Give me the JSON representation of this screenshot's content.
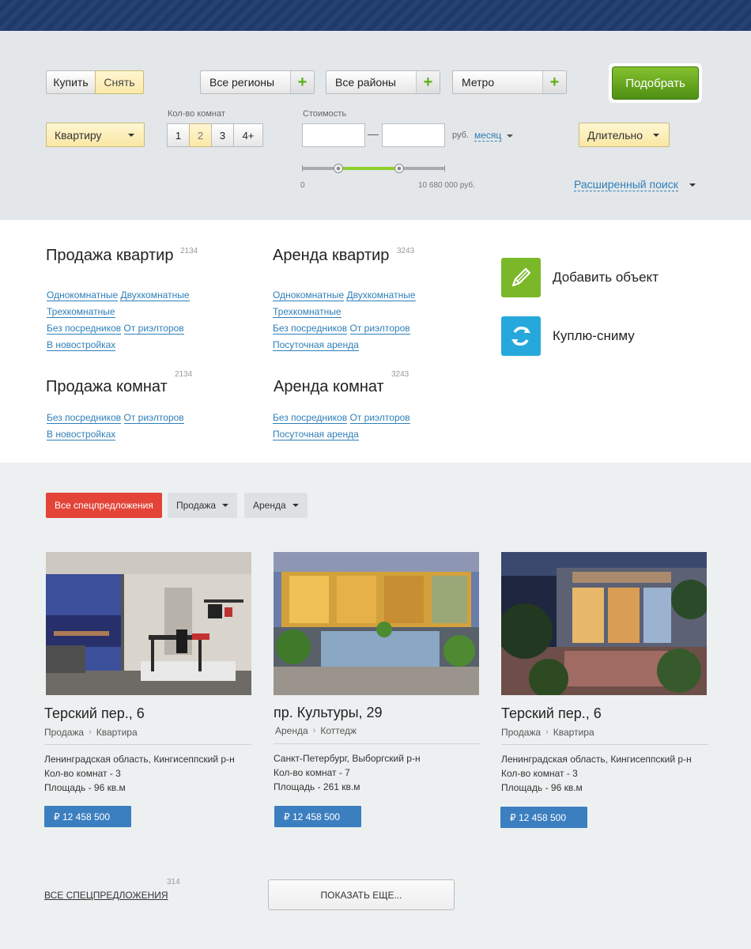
{
  "search": {
    "mode_buy": "Купить",
    "mode_rent": "Снять",
    "regions": "Все регионы",
    "districts": "Все районы",
    "metro": "Метро",
    "submit": "Подобрать",
    "property_type": "Квартиру",
    "rooms_label": "Кол-во комнат",
    "rooms": [
      "1",
      "2",
      "3",
      "4+"
    ],
    "rooms_active": "2",
    "price_label": "Стоимость",
    "price_dash": "—",
    "currency": "руб.",
    "period": "месяц",
    "duration": "Длительно",
    "slider_min": "0",
    "slider_max": "10 680 000 руб.",
    "advanced": "Расширенный поиск"
  },
  "categories": [
    {
      "title": "Продажа квартир",
      "count": "2134",
      "links": [
        "Однокомнатные",
        "Двухкомнатные",
        "Трехкомнатные",
        "Без посредников",
        "От риэлторов",
        "В новостройках"
      ]
    },
    {
      "title": "Аренда квартир",
      "count": "3243",
      "links": [
        "Однокомнатные",
        "Двухкомнатные",
        "Трехкомнатные",
        "Без посредников",
        "От риэлторов",
        "Посуточная аренда"
      ]
    },
    {
      "title": "Продажа комнат",
      "count": "2134",
      "links": [
        "Без посредников",
        "От риэлторов",
        "В новостройках"
      ]
    },
    {
      "title": "Аренда комнат",
      "count": "3243",
      "links": [
        "Без посредников",
        "От риэлторов",
        "Посуточная аренда"
      ]
    }
  ],
  "side_actions": {
    "add": "Добавить объект",
    "buy_rent": "Куплю-сниму",
    "add_color": "#7ab829",
    "buy_rent_color": "#27a8dc"
  },
  "filters": {
    "all": "Все спецпредложения",
    "sale": "Продажа",
    "rent": "Аренда"
  },
  "cards": [
    {
      "title": "Терский пер., 6",
      "deal": "Продажа",
      "type": "Квартира",
      "location": "Ленинградская область, Кингисеппский р-н",
      "rooms": "Кол-во комнат - 3",
      "area": "Площадь  - 96 кв.м",
      "price": "₽  12 458 500"
    },
    {
      "title": "пр. Культуры, 29",
      "deal": "Аренда",
      "type": "Коттедж",
      "location": "Санкт-Петербург, Выборгский р-н",
      "rooms": "Кол-во комнат - 7",
      "area": "Площадь  - 261 кв.м",
      "price": "₽  12 458 500"
    },
    {
      "title": "Терский пер., 6",
      "deal": "Продажа",
      "type": "Квартира",
      "location": "Ленинградская область, Кингисеппский р-н",
      "rooms": "Кол-во комнат - 3",
      "area": "Площадь  - 96 кв.м",
      "price": "₽  12 458 500"
    }
  ],
  "footer": {
    "all_offers": "ВСЕ СПЕЦПРЕДЛОЖЕНИЯ",
    "all_count": "314",
    "show_more": "ПОКАЗАТЬ ЕЩЕ..."
  }
}
